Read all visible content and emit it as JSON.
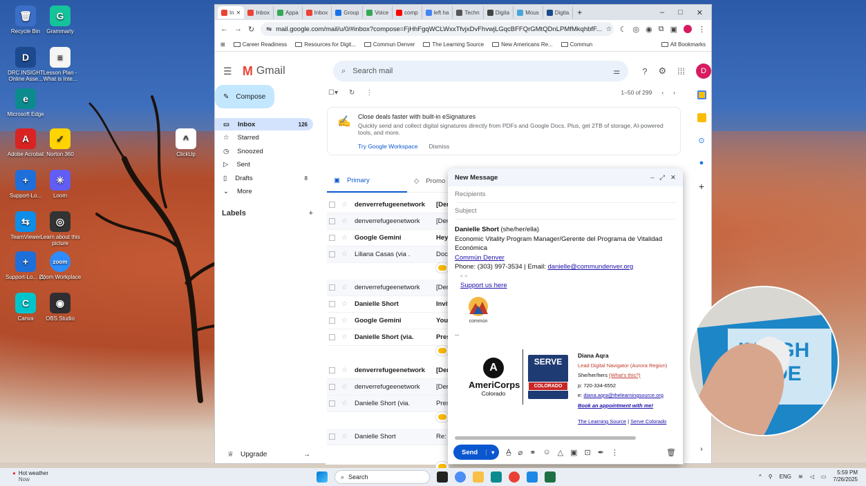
{
  "desktop": {
    "icons": [
      {
        "label": "Recycle Bin",
        "color": "#3b6fc7",
        "glyph": "🗑"
      },
      {
        "label": "Grammarly",
        "color": "#15c39a",
        "glyph": "G"
      },
      {
        "label": "DRC INSIGHT Online Asse...",
        "color": "#1d4a8f",
        "glyph": "D"
      },
      {
        "label": "Lesson Plan - What is Inte...",
        "color": "#f5f5f5",
        "glyph": "≡"
      },
      {
        "label": "Microsoft Edge",
        "color": "#0c8b8f",
        "glyph": "e"
      },
      {
        "label": "Adobe Acrobat",
        "color": "#d92323",
        "glyph": "A"
      },
      {
        "label": "Norton 360",
        "color": "#ffd400",
        "glyph": "✓"
      },
      {
        "label": "ClickUp",
        "color": "#ffffff",
        "glyph": "^"
      },
      {
        "label": "Support-Lo...",
        "color": "#1e6fd9",
        "glyph": "+"
      },
      {
        "label": "Loom",
        "color": "#625df5",
        "glyph": "✳"
      },
      {
        "label": "TeamViewer",
        "color": "#0e8ee9",
        "glyph": "⇆"
      },
      {
        "label": "Learn about this picture",
        "color": "#333",
        "glyph": "◎"
      },
      {
        "label": "Support-Lo... (1)",
        "color": "#1e6fd9",
        "glyph": "+"
      },
      {
        "label": "Zoom Workplace",
        "color": "#2d8cff",
        "glyph": "zoom"
      },
      {
        "label": "Canva",
        "color": "#00c4cc",
        "glyph": "C"
      },
      {
        "label": "OBS Studio",
        "color": "#302e31",
        "glyph": "◉"
      }
    ]
  },
  "browser": {
    "tabs": [
      {
        "label": "In",
        "color": "#ea4335",
        "active": true
      },
      {
        "label": "Inbox",
        "color": "#ea4335"
      },
      {
        "label": "Appa",
        "color": "#34a853"
      },
      {
        "label": "Inbox",
        "color": "#ea4335"
      },
      {
        "label": "Group",
        "color": "#1a73e8"
      },
      {
        "label": "Voice",
        "color": "#34a853"
      },
      {
        "label": "comp",
        "color": "#ff0000"
      },
      {
        "label": "left ha",
        "color": "#4285f4"
      },
      {
        "label": "Techn",
        "color": "#555"
      },
      {
        "label": "Digita",
        "color": "#444"
      },
      {
        "label": "Mous",
        "color": "#4aa5d8"
      },
      {
        "label": "Digita",
        "color": "#1a4a8a"
      }
    ],
    "tab_close": "✕",
    "new_tab": "+",
    "url": "mail.google.com/mail/u/0/#inbox?compose=FjHhFgqWCLWxxTfvjxDvFhvwjLGqcBFFQrGMtQDnLPMfMkqhbfF...",
    "bookmarks": [
      "Career Readiness",
      "Resources for Digit...",
      "Commun Denver",
      "The Learning Source",
      "New Americans Re...",
      "Commun"
    ],
    "all_bookmarks": "All Bookmarks"
  },
  "gmail": {
    "brand": "Gmail",
    "search_placeholder": "Search mail",
    "avatar": "D",
    "compose_label": "Compose",
    "nav": [
      {
        "label": "Inbox",
        "count": "126",
        "icon": "inbox-icon",
        "glyph": "▭",
        "active": true
      },
      {
        "label": "Starred",
        "count": "",
        "icon": "star-icon",
        "glyph": "☆"
      },
      {
        "label": "Snoozed",
        "count": "",
        "icon": "clock-icon",
        "glyph": "◷"
      },
      {
        "label": "Sent",
        "count": "",
        "icon": "send-icon",
        "glyph": "▷"
      },
      {
        "label": "Drafts",
        "count": "8",
        "icon": "draft-icon",
        "glyph": "▯"
      },
      {
        "label": "More",
        "count": "",
        "icon": "chevron-down-icon",
        "glyph": "⌄"
      }
    ],
    "labels_title": "Labels",
    "upgrade_label": "Upgrade",
    "pagination": "1–50 of 299",
    "promo": {
      "title": "Close deals faster with built-in eSignatures",
      "body": "Quickly send and collect digital signatures directly from PDFs and Google Docs. Plus, get 2TB of storage, AI-powered tools, and more.",
      "cta": "Try Google Workspace",
      "dismiss": "Dismiss"
    },
    "categories": [
      {
        "label": "Primary",
        "active": true
      },
      {
        "label": "Promo",
        "active": false
      }
    ],
    "emails": [
      {
        "sender": "denverrefugeenetwork",
        "subject": "[Der",
        "unread": true
      },
      {
        "sender": "denverrefugeenetwork",
        "subject": "[Den",
        "unread": false
      },
      {
        "sender": "Google Gemini",
        "subject": "Hey",
        "unread": true
      },
      {
        "sender": "Liliana Casas (via .",
        "subject": "Docu",
        "unread": false
      },
      {
        "sender": "denverrefugeenetwork",
        "subject": "[Den",
        "unread": false
      },
      {
        "sender": "Danielle Short",
        "subject": "Invit",
        "unread": true
      },
      {
        "sender": "Google Gemini",
        "subject": "You'",
        "unread": true
      },
      {
        "sender": "Danielle Short (via.",
        "subject": "Pres",
        "unread": true
      },
      {
        "sender": "denverrefugeenetwork",
        "subject": "[Der",
        "unread": true
      },
      {
        "sender": "denverrefugeenetwork",
        "subject": "[Den",
        "unread": false
      },
      {
        "sender": "Danielle Short (via.",
        "subject": "Pres",
        "unread": false
      },
      {
        "sender": "Danielle Short",
        "subject": "Re: F",
        "unread": false
      }
    ]
  },
  "compose": {
    "title": "New Message",
    "recipients_placeholder": "Recipients",
    "subject_placeholder": "Subject",
    "signature": {
      "name": "Danielle Short",
      "pronouns": "(she/her/ella)",
      "title": "Economic Vitality Program Manager/Gerente del Programa de Vitalidad Económica",
      "org_link": "Commún Denver",
      "phone_line": "Phone: (303) 997-3534 | Email: ",
      "email": "danielle@commundenver.org",
      "support": "Support us here",
      "logo_text": "commún",
      "separator": "--"
    },
    "diana": {
      "name": "Diana Aqra",
      "role": "Lead Digital Navigator (Aurora Region)",
      "pronouns": "She/her/hers ",
      "pronouns_link": "(What's this?)",
      "phone": "p: 720-334-6552",
      "email_prefix": "e: ",
      "email": "diana.aqra@thelearningsource.org",
      "booking": "Book an appointment with me!",
      "org1": "The Learning Source",
      "sep": " | ",
      "org2": "Serve Colorado",
      "americorps": "AmeriCorps",
      "americorps_sub": "Colorado",
      "serve": "SERVE",
      "serve_sub": "COLORADO"
    },
    "send_label": "Send"
  },
  "taskbar": {
    "weather_title": "Hot weather",
    "weather_sub": "Now",
    "search_placeholder": "Search",
    "lang": "ENG",
    "time": "5:59 PM",
    "date": "7/26/2025"
  },
  "webcam": {
    "sign_text_1": "INSIGH",
    "sign_text_2": "DE"
  }
}
